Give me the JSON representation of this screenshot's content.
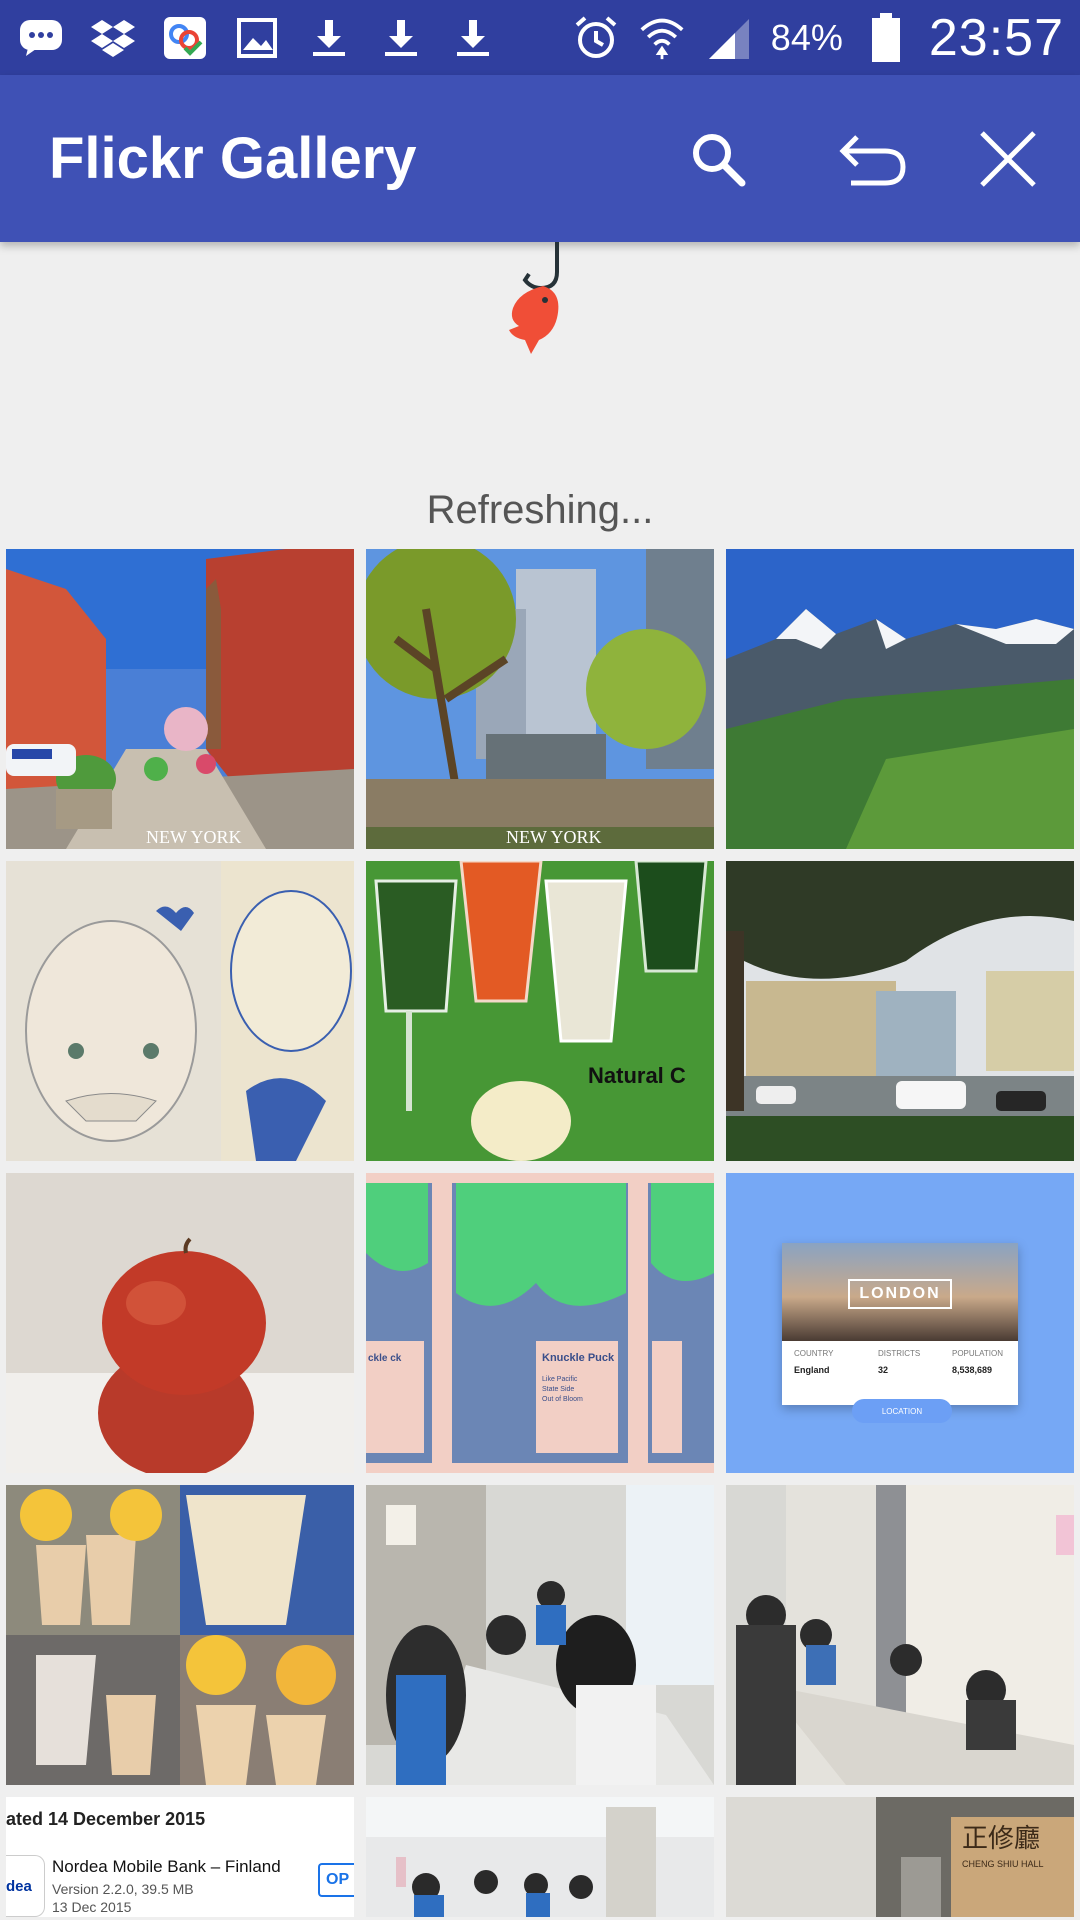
{
  "status_bar": {
    "icons": [
      "messages-icon",
      "dropbox-icon",
      "photos-sync-icon",
      "gallery-icon",
      "download-icon",
      "download-icon",
      "download-icon"
    ],
    "right_icons": [
      "alarm-icon",
      "wifi-icon",
      "cell-signal-icon",
      "battery-icon"
    ],
    "battery": "84%",
    "time": "23:57"
  },
  "app_bar": {
    "title": "Flickr Gallery",
    "actions": [
      "search-icon",
      "undo-icon",
      "close-icon"
    ]
  },
  "refresh": {
    "text": "Refreshing..."
  },
  "tiles": [
    {
      "name": "new-york-street-photo",
      "caption": "NEW YORK"
    },
    {
      "name": "new-york-park-photo",
      "caption": "NEW YORK"
    },
    {
      "name": "mountain-landscape-photo"
    },
    {
      "name": "blue-girl-illustration-photo"
    },
    {
      "name": "juice-glasses-photo",
      "caption": "Natural C"
    },
    {
      "name": "office-campus-photo"
    },
    {
      "name": "apple-photo"
    },
    {
      "name": "knuckle-puck-poster-photo",
      "poster_title": "Knuckle Puck",
      "poster_lines": [
        "Like Pacific",
        "State Side",
        "Out of Bloom"
      ],
      "poster_left_title": "ckle ck"
    },
    {
      "name": "london-app-design-photo"
    },
    {
      "name": "smoothie-collage-photo"
    },
    {
      "name": "students-registration-photo"
    },
    {
      "name": "registration-table-photo"
    },
    {
      "name": "app-update-screenshot"
    },
    {
      "name": "hallway-students-photo"
    },
    {
      "name": "cheng-shiu-hall-photo"
    }
  ],
  "london_card": {
    "city": "LONDON",
    "country_label": "COUNTRY",
    "country": "England",
    "districts_label": "DISTRICTS",
    "districts": "32",
    "population_label": "POPULATION",
    "population": "8,538,689",
    "button": "LOCATION"
  },
  "bank_app": {
    "updated": "ated 14 December 2015",
    "logo": "dea",
    "name": "Nordea Mobile Bank – Finland",
    "version": "Version 2.2.0, 39.5 MB",
    "date": "13 Dec 2015",
    "open": "OP"
  },
  "hall_sign": {
    "chinese": "正修廳",
    "english": "CHENG SHIU HALL"
  },
  "colors": {
    "status_bar": "#303f9f",
    "app_bar": "#3f51b5",
    "background": "#efefef",
    "fish": "#f04e37"
  }
}
